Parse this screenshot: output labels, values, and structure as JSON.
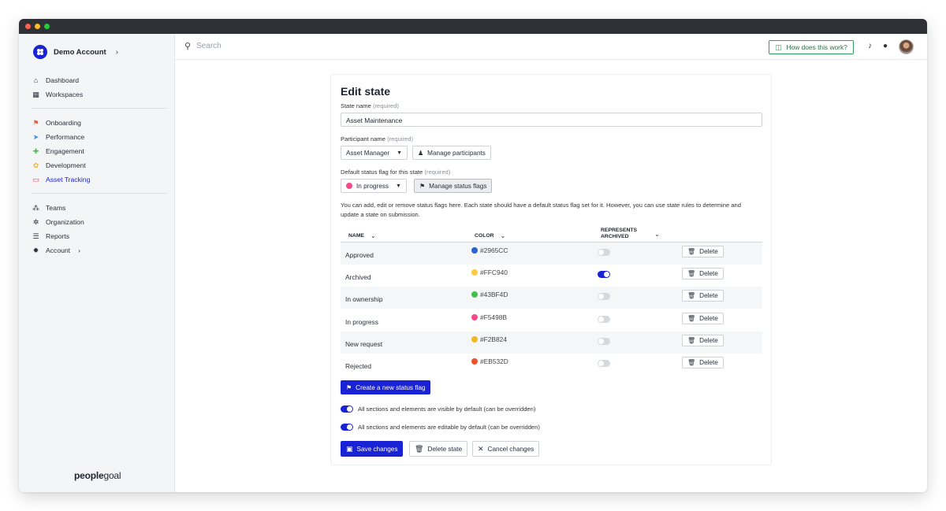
{
  "sidebar": {
    "account_name": "Demo Account",
    "group1": [
      {
        "label": "Dashboard",
        "icon": "home-icon"
      },
      {
        "label": "Workspaces",
        "icon": "grid-icon"
      }
    ],
    "group2": [
      {
        "label": "Onboarding",
        "icon": "flag-icon",
        "color": "#f0593e"
      },
      {
        "label": "Performance",
        "icon": "send-icon",
        "color": "#3b8be8"
      },
      {
        "label": "Engagement",
        "icon": "puzzle-icon",
        "color": "#43bf4d"
      },
      {
        "label": "Development",
        "icon": "sprout-icon",
        "color": "#f2b824"
      },
      {
        "label": "Asset Tracking",
        "icon": "laptop-icon",
        "color": "#eb3a56",
        "active": true
      }
    ],
    "group3": [
      {
        "label": "Teams",
        "icon": "teams-icon"
      },
      {
        "label": "Organization",
        "icon": "org-icon"
      },
      {
        "label": "Reports",
        "icon": "reports-icon"
      },
      {
        "label": "Account",
        "icon": "cog-icon"
      }
    ],
    "brand_bold": "people",
    "brand_light": "goal"
  },
  "topbar": {
    "search_placeholder": "Search",
    "how_label": "How does this work?"
  },
  "form": {
    "title": "Edit state",
    "state_name_label": "State name",
    "required": "(required)",
    "state_name_value": "Asset Maintenance",
    "participant_label": "Participant name",
    "participant_value": "Asset Manager",
    "manage_participants": "Manage participants",
    "default_flag_label": "Default status flag for this state",
    "default_flag_value": "In progress",
    "default_flag_color": "#F5498B",
    "manage_flags": "Manage status flags",
    "help_text": "You can add, edit or remove status flags here. Each state should have a default status flag set for it. However, you can use state rules to determine and update a state on submission.",
    "columns": {
      "name": "NAME",
      "color": "COLOR",
      "archived_line1": "REPRESENTS",
      "archived_line2": "ARCHIVED"
    },
    "flags": [
      {
        "name": "Approved",
        "color": "#2965CC",
        "archived": false
      },
      {
        "name": "Archived",
        "color": "#FFC940",
        "archived": true
      },
      {
        "name": "In ownership",
        "color": "#43BF4D",
        "archived": false
      },
      {
        "name": "In progress",
        "color": "#F5498B",
        "archived": false
      },
      {
        "name": "New request",
        "color": "#F2B824",
        "archived": false
      },
      {
        "name": "Rejected",
        "color": "#EB532D",
        "archived": false
      }
    ],
    "delete_label": "Delete",
    "create_flag": "Create a new status flag",
    "visible_option": "All sections and elements are visible by default (can be overridden)",
    "editable_option": "All sections and elements are editable by default (can be overridden)",
    "save": "Save changes",
    "delete_state": "Delete state",
    "cancel": "Cancel changes"
  }
}
